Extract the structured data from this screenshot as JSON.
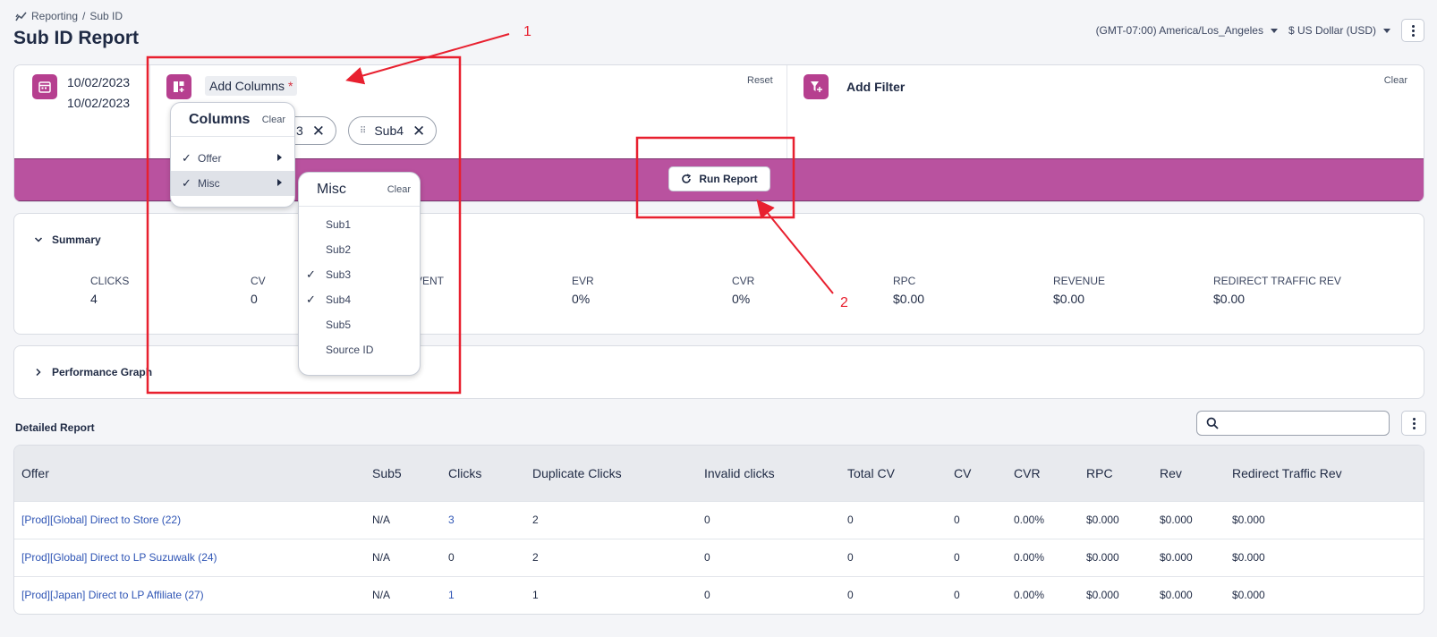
{
  "breadcrumb": {
    "root": "Reporting",
    "separator": "/",
    "current": "Sub ID"
  },
  "page_title": "Sub ID Report",
  "timezone": "(GMT-07:00) America/Los_Angeles",
  "currency": "$ US Dollar (USD)",
  "date_range": {
    "start": "10/02/2023",
    "end": "10/02/2023"
  },
  "columns_panel": {
    "label": "Add Columns",
    "required_mark": "*",
    "reset": "Reset",
    "chips": [
      {
        "label": "Sub3",
        "visible_fragment": "3"
      },
      {
        "label": "Sub4"
      }
    ]
  },
  "filter_panel": {
    "label": "Add Filter",
    "clear": "Clear"
  },
  "run_report": "Run Report",
  "columns_dropdown": {
    "title": "Columns",
    "clear": "Clear",
    "items": [
      {
        "label": "Offer",
        "checked": true,
        "has_submenu": true
      },
      {
        "label": "Misc",
        "checked": true,
        "has_submenu": true,
        "active": true
      }
    ]
  },
  "misc_dropdown": {
    "title": "Misc",
    "clear": "Clear",
    "items": [
      {
        "label": "Sub1",
        "checked": false
      },
      {
        "label": "Sub2",
        "checked": false
      },
      {
        "label": "Sub3",
        "checked": true
      },
      {
        "label": "Sub4",
        "checked": true
      },
      {
        "label": "Sub5",
        "checked": false
      },
      {
        "label": "Source ID",
        "checked": false
      }
    ]
  },
  "summary": {
    "title": "Summary",
    "metrics": [
      {
        "label": "CLICKS",
        "value": "4"
      },
      {
        "label": "CV",
        "value": "0"
      },
      {
        "label": "VENT",
        "value": ""
      },
      {
        "label": "EVR",
        "value": "0%"
      },
      {
        "label": "CVR",
        "value": "0%"
      },
      {
        "label": "RPC",
        "value": "$0.00"
      },
      {
        "label": "REVENUE",
        "value": "$0.00"
      },
      {
        "label": "REDIRECT TRAFFIC REV",
        "value": "$0.00"
      }
    ]
  },
  "performance_graph": {
    "title": "Performance Graph"
  },
  "detailed_report": {
    "title": "Detailed Report",
    "columns": [
      "Offer",
      "Sub5",
      "Clicks",
      "Duplicate Clicks",
      "Invalid clicks",
      "Total CV",
      "CV",
      "CVR",
      "RPC",
      "Rev",
      "Redirect Traffic Rev"
    ],
    "rows": [
      [
        "[Prod][Global] Direct to Store (22)",
        "N/A",
        "3",
        "2",
        "0",
        "0",
        "0",
        "0.00%",
        "$0.000",
        "$0.000",
        "$0.000"
      ],
      [
        "[Prod][Global] Direct to LP Suzuwalk (24)",
        "N/A",
        "0",
        "2",
        "0",
        "0",
        "0",
        "0.00%",
        "$0.000",
        "$0.000",
        "$0.000"
      ],
      [
        "[Prod][Japan] Direct to LP Affiliate (27)",
        "N/A",
        "1",
        "1",
        "0",
        "0",
        "0",
        "0.00%",
        "$0.000",
        "$0.000",
        "$0.000"
      ]
    ],
    "link_clicks": [
      true,
      false,
      true
    ]
  },
  "annotations": {
    "label_1": "1",
    "label_2": "2",
    "color": "#e8202f"
  },
  "colors": {
    "accent": "#b63f8f",
    "run_bar": "#b9529f",
    "link": "#2f55b5"
  }
}
